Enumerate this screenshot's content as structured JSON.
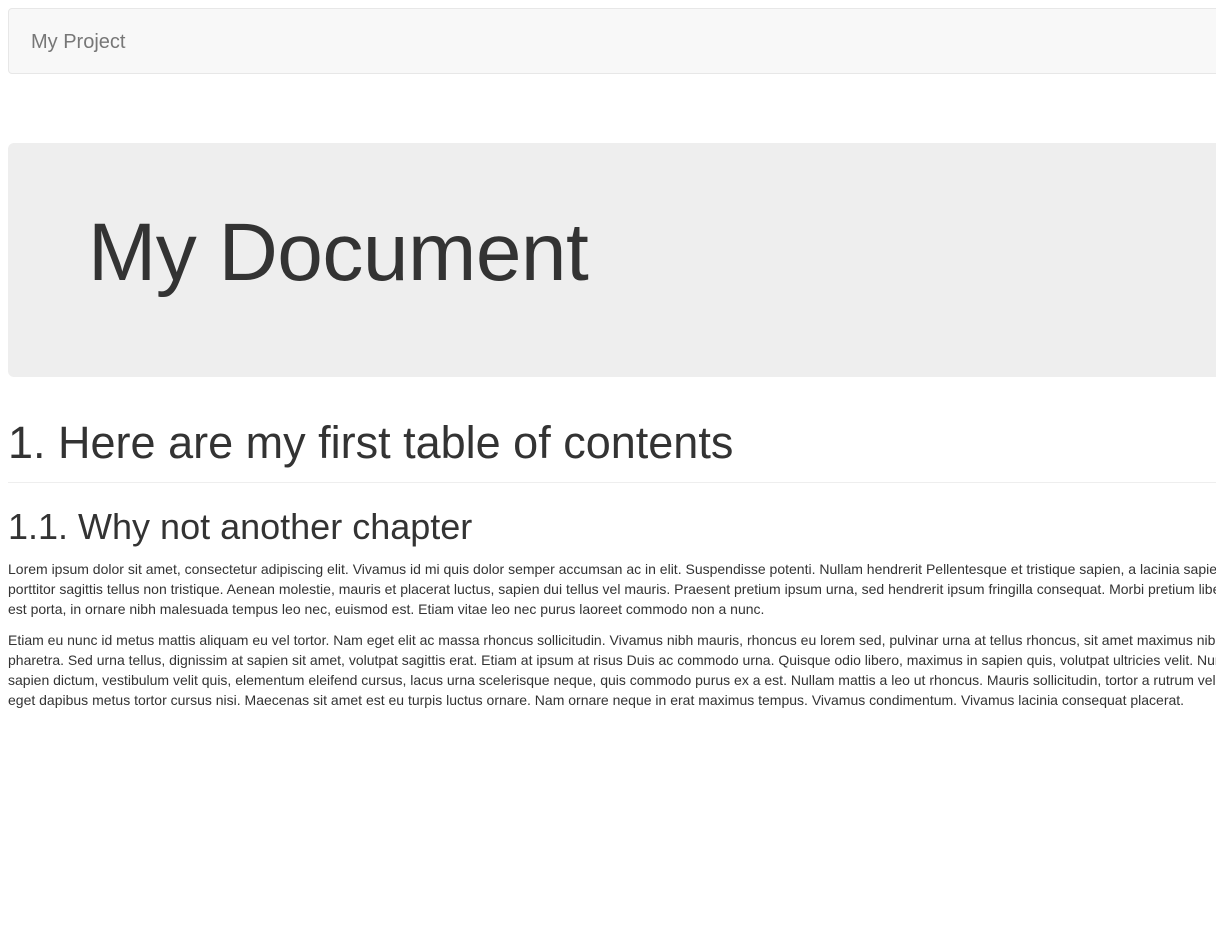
{
  "navbar": {
    "brand": "My Project"
  },
  "jumbotron": {
    "title": "My Document"
  },
  "content": {
    "chapter_title": "1. Here are my first table of contents",
    "section_title": "1.1. Why not another chapter",
    "paragraphs": [
      "Lorem ipsum dolor sit amet, consectetur adipiscing elit. Vivamus id mi quis dolor semper accumsan ac in elit. Suspendisse potenti. Nullam hendrerit Pellentesque et tristique sapien, a lacinia sapien. Sed porttitor sagittis tellus non tristique. Aenean molestie, mauris et placerat luctus, sapien dui tellus vel mauris. Praesent pretium ipsum urna, sed hendrerit ipsum fringilla consequat. Morbi pretium libero non est porta, in ornare nibh malesuada tempus leo nec, euismod est. Etiam vitae leo nec purus laoreet commodo non a nunc.",
      "Etiam eu nunc id metus mattis aliquam eu vel tortor. Nam eget elit ac massa rhoncus sollicitudin. Vivamus nibh mauris, rhoncus eu lorem sed, pulvinar urna at tellus rhoncus, sit amet maximus nibh pharetra. Sed urna tellus, dignissim at sapien sit amet, volutpat sagittis erat. Etiam at ipsum at risus Duis ac commodo urna. Quisque odio libero, maximus in sapien quis, volutpat ultricies velit. Nunc a sapien dictum, vestibulum velit quis, elementum eleifend cursus, lacus urna scelerisque neque, quis commodo purus ex a est. Nullam mattis a leo ut rhoncus. Mauris sollicitudin, tortor a rutrum vel justo, eget dapibus metus tortor cursus nisi. Maecenas sit amet est eu turpis luctus ornare. Nam ornare neque in erat maximus tempus. Vivamus condimentum. Vivamus lacinia consequat placerat."
    ]
  }
}
